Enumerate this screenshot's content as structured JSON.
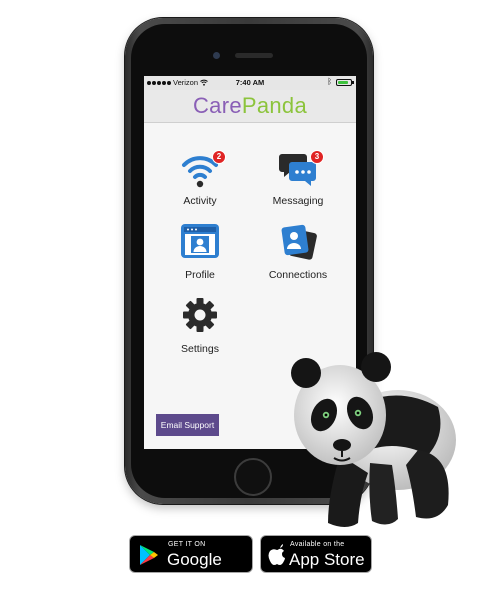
{
  "status_bar": {
    "carrier": "Verizon",
    "time": "7:40 AM",
    "battery_level_percent": 85
  },
  "app": {
    "logo_part1": "Care",
    "logo_part2": "Panda",
    "colors": {
      "logo_care": "#8a5fb6",
      "logo_panda": "#8cc43c",
      "badge": "#e02424",
      "button": "#5d4a8c",
      "icon_blue": "#2e7fd0"
    }
  },
  "menu": {
    "activity": {
      "label": "Activity",
      "badge": "2",
      "icon": "wifi-signal-icon"
    },
    "messaging": {
      "label": "Messaging",
      "badge": "3",
      "icon": "chat-bubbles-icon"
    },
    "profile": {
      "label": "Profile",
      "icon": "profile-card-icon"
    },
    "connections": {
      "label": "Connections",
      "icon": "contacts-icon"
    },
    "settings": {
      "label": "Settings",
      "icon": "gear-icon"
    }
  },
  "email_support_label": "Email Support",
  "stores": {
    "google": {
      "small": "GET IT ON",
      "big": "Google Play"
    },
    "apple": {
      "small": "Available on the",
      "big": "App Store"
    }
  }
}
